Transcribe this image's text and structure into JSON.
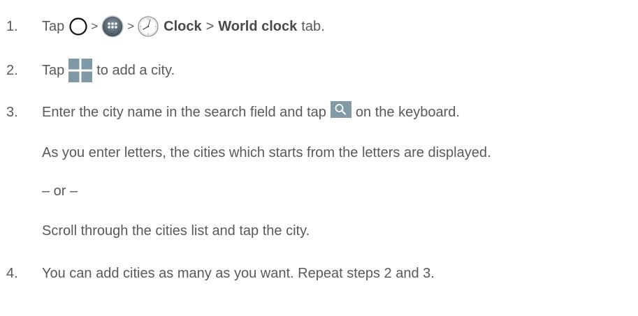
{
  "steps": [
    {
      "number": "1.",
      "tap": "Tap",
      "sep1": ">",
      "sep2": ">",
      "clock": "Clock",
      "sep3": ">",
      "world_clock": "World clock",
      "tab": "tab."
    },
    {
      "number": "2.",
      "tap": "Tap",
      "rest": "to add a city."
    },
    {
      "number": "3.",
      "text_before": "Enter the city name in the search field and tap",
      "text_after": "on the keyboard.",
      "note": "As you enter letters, the cities which starts from the letters are displayed.",
      "or": "– or –",
      "alt": "Scroll through the cities list and tap the city."
    },
    {
      "number": "4.",
      "text": "You can add cities as many as you want. Repeat steps 2 and 3."
    }
  ],
  "icons": {
    "home": "home-circle-icon",
    "apps": "apps-grid-icon",
    "clock": "clock-icon",
    "add": "add-plus-icon",
    "search": "search-icon"
  },
  "colors": {
    "text": "#595959",
    "add_icon_bg": "#7f9aa6",
    "search_icon_bg": "#8299a6",
    "apps_icon_bg": "#5b6b78"
  }
}
